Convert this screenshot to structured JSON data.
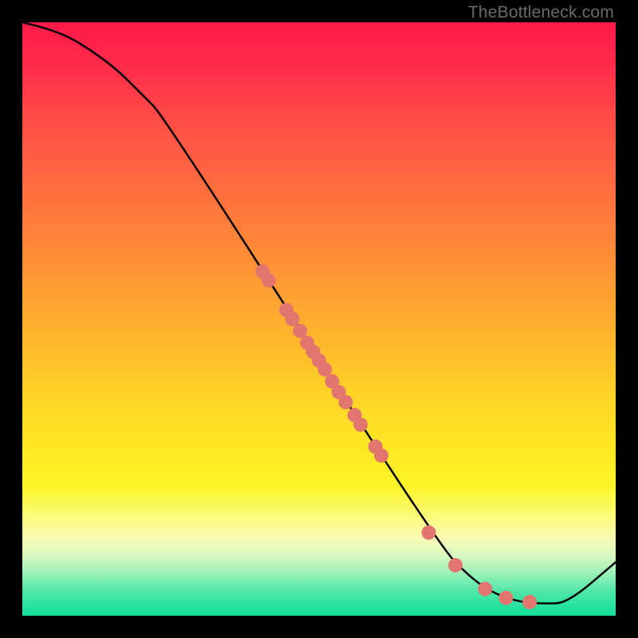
{
  "watermark": "TheBottleneck.com",
  "chart_data": {
    "type": "line",
    "title": "",
    "xlabel": "",
    "ylabel": "",
    "xlim": [
      0,
      100
    ],
    "ylim": [
      0,
      100
    ],
    "grid": false,
    "curve": {
      "x": [
        0,
        4,
        8,
        12,
        16,
        20,
        24,
        70,
        76,
        80,
        84,
        88,
        92,
        100
      ],
      "y": [
        100,
        99,
        97.5,
        95,
        92,
        88,
        84,
        12,
        6,
        3.5,
        2.3,
        2,
        2.2,
        9
      ]
    },
    "scatter": {
      "color": "#e2766f",
      "radius": 9,
      "points": [
        {
          "x": 40.5,
          "y": 58.0
        },
        {
          "x": 41.5,
          "y": 56.5
        },
        {
          "x": 44.5,
          "y": 51.5
        },
        {
          "x": 45.5,
          "y": 50.0
        },
        {
          "x": 46.8,
          "y": 48.0
        },
        {
          "x": 48.0,
          "y": 46.0
        },
        {
          "x": 49.0,
          "y": 44.5
        },
        {
          "x": 50.0,
          "y": 43.0
        },
        {
          "x": 51.0,
          "y": 41.5
        },
        {
          "x": 52.2,
          "y": 39.5
        },
        {
          "x": 53.3,
          "y": 37.7
        },
        {
          "x": 54.5,
          "y": 36.0
        },
        {
          "x": 56.0,
          "y": 33.8
        },
        {
          "x": 57.0,
          "y": 32.2
        },
        {
          "x": 59.5,
          "y": 28.5
        },
        {
          "x": 60.5,
          "y": 27.0
        },
        {
          "x": 68.5,
          "y": 14.0
        },
        {
          "x": 73.0,
          "y": 8.5
        },
        {
          "x": 78.0,
          "y": 4.5
        },
        {
          "x": 81.5,
          "y": 3.0
        },
        {
          "x": 85.5,
          "y": 2.3
        }
      ]
    }
  }
}
